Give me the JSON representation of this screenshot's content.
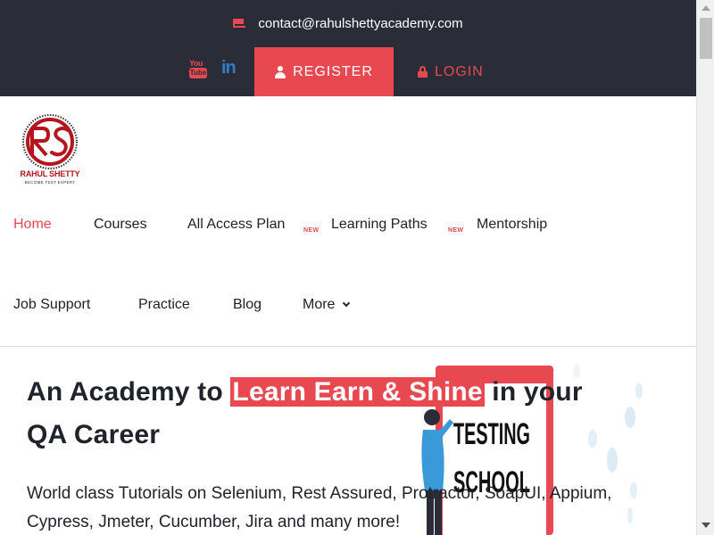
{
  "topbar": {
    "contact_email": "contact@rahulshettyacademy.com",
    "youtube_label_top": "You",
    "youtube_label_bottom": "Tube",
    "linkedin_label": "in",
    "register_label": "REGISTER",
    "login_label": "LOGIN"
  },
  "logo": {
    "name": "RAHUL SHETTY",
    "tagline": "BECOME TEST EXPERT",
    "monogram": "RS"
  },
  "nav": {
    "items": [
      {
        "label": "Home",
        "active": true
      },
      {
        "label": "Courses"
      },
      {
        "label": "All Access Plan",
        "badge": "NEW"
      },
      {
        "label": "Learning Paths",
        "badge": "NEW"
      },
      {
        "label": "Mentorship"
      },
      {
        "label": "Job Support"
      },
      {
        "label": "Practice"
      },
      {
        "label": "Blog"
      },
      {
        "label": "More"
      }
    ]
  },
  "hero": {
    "title_prefix": "An Academy to",
    "title_highlight": "Learn Earn & Shine",
    "title_suffix": " in your",
    "title_line2": "QA Career",
    "subtitle_line1": "World class Tutorials on Selenium, Rest Assured, Protractor, SoapUI, Appium,",
    "subtitle_line2": "Cypress, Jmeter, Cucumber, Jira and many more!",
    "illustration_text_1": "TESTING",
    "illustration_text_2": "SCHOOL"
  },
  "colors": {
    "topbar_bg": "#2a2d37",
    "accent": "#e8484f",
    "linkedin": "#2e7ec8",
    "text_dark": "#20232c"
  }
}
